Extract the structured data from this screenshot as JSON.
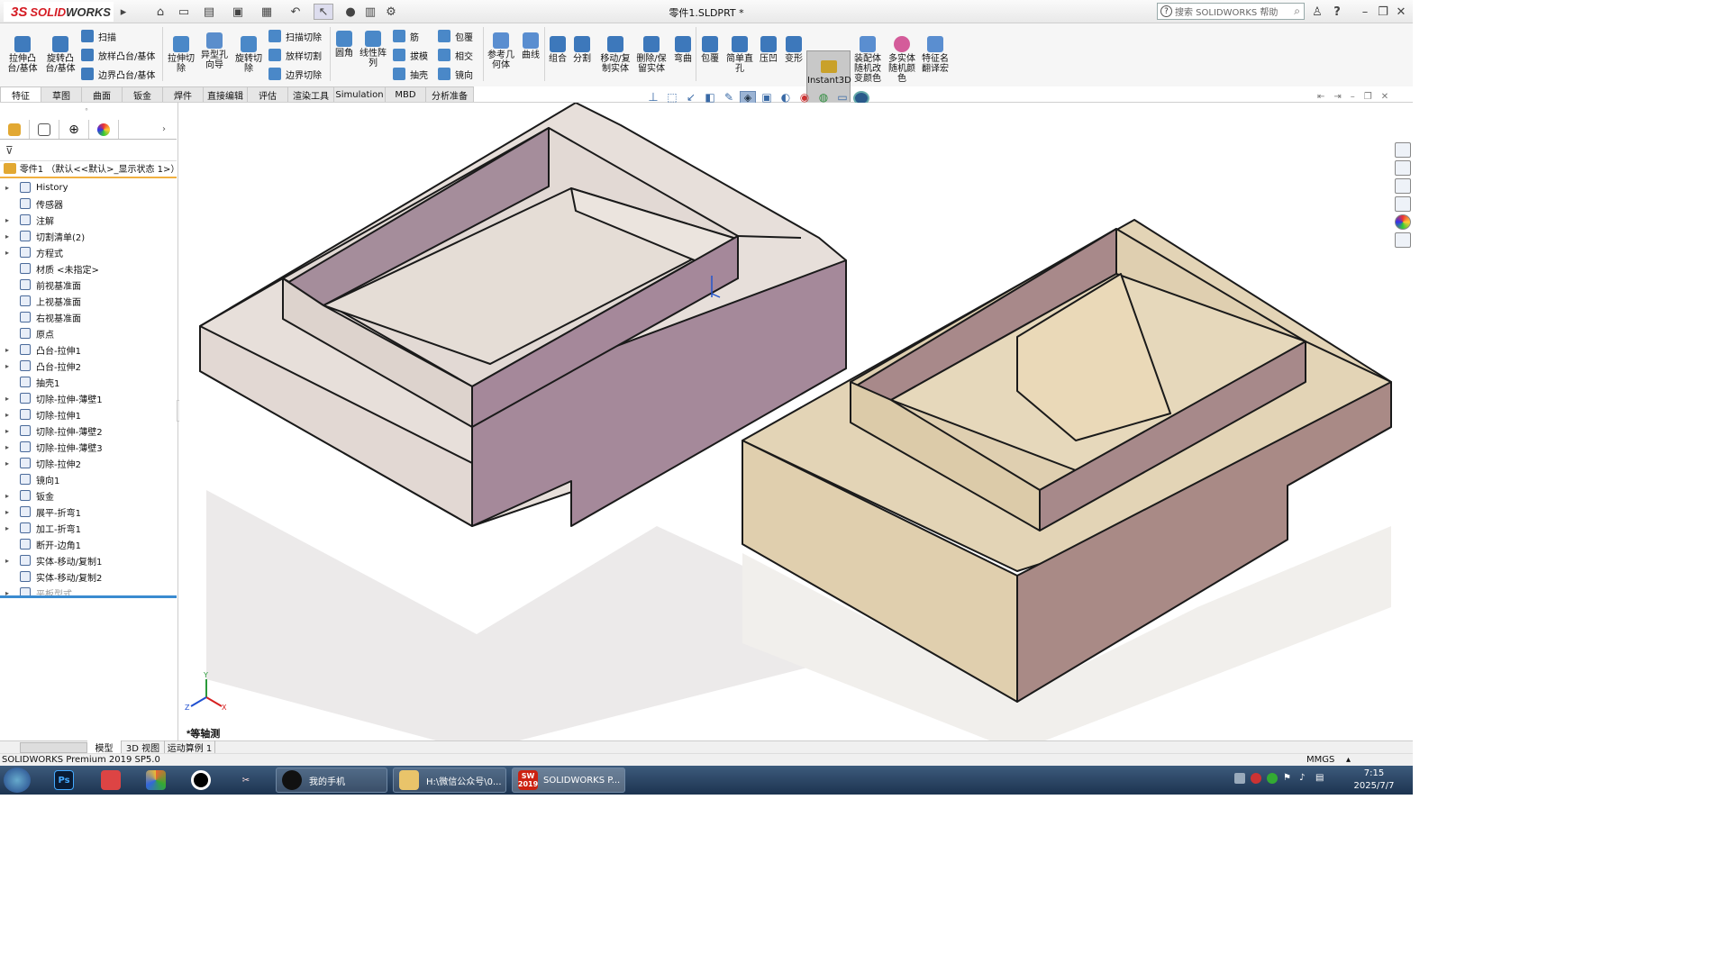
{
  "titlebar": {
    "logo_ds": "3S",
    "logo_solid": "SOLID",
    "logo_works": "WORKS",
    "doc_title": "零件1.SLDPRT *",
    "search_placeholder": "搜索 SOLIDWORKS 帮助",
    "help": "?"
  },
  "ribbon": {
    "large": [
      {
        "label": "拉伸凸\n台/基体",
        "color": "#3f7bbd"
      },
      {
        "label": "旋转凸\n台/基体",
        "color": "#3f7bbd"
      },
      {
        "label": "拉伸切\n除",
        "color": "#4a88c8"
      },
      {
        "label": "异型孔\n向导",
        "color": "#5b8ecc"
      },
      {
        "label": "旋转切\n除",
        "color": "#4a88c8"
      },
      {
        "label": "圆角",
        "color": "#4a88c8"
      },
      {
        "label": "线性阵\n列",
        "color": "#4a88c8"
      },
      {
        "label": "参考几\n何体",
        "color": "#5a8ed0"
      },
      {
        "label": "曲线",
        "color": "#5a8ed0"
      },
      {
        "label": "组合",
        "color": "#3d78bb"
      },
      {
        "label": "分割",
        "color": "#3d78bb"
      },
      {
        "label": "移动/复\n制实体",
        "color": "#3d78bb"
      },
      {
        "label": "删除/保\n留实体",
        "color": "#3d78bb"
      },
      {
        "label": "弯曲",
        "color": "#3d78bb"
      },
      {
        "label": "包覆",
        "color": "#3d78bb"
      },
      {
        "label": "简单直\n孔",
        "color": "#3d78bb"
      },
      {
        "label": "压凹",
        "color": "#3d78bb"
      },
      {
        "label": "变形",
        "color": "#3d78bb"
      },
      {
        "label": "装配体\n随机改\n变颜色",
        "color": "#5a8ed0"
      },
      {
        "label": "多实体\n随机颜\n色",
        "color": "#d45c9a"
      },
      {
        "label": "特征名\n翻译宏",
        "color": "#5a8ed0"
      }
    ],
    "small": [
      {
        "label": "扫描",
        "color": "#3f7bbd"
      },
      {
        "label": "放样凸台/基体",
        "color": "#3f7bbd"
      },
      {
        "label": "边界凸台/基体",
        "color": "#3f7bbd"
      },
      {
        "label": "扫描切除",
        "color": "#4a88c8"
      },
      {
        "label": "放样切割",
        "color": "#4a88c8"
      },
      {
        "label": "边界切除",
        "color": "#4a88c8"
      },
      {
        "label": "筋",
        "color": "#4a88c8"
      },
      {
        "label": "拔模",
        "color": "#4a88c8"
      },
      {
        "label": "抽壳",
        "color": "#4a88c8"
      },
      {
        "label": "包覆",
        "color": "#4a88c8"
      },
      {
        "label": "相交",
        "color": "#4a88c8"
      },
      {
        "label": "镜向",
        "color": "#4a88c8"
      }
    ],
    "instant3d": "Instant3D"
  },
  "tabs": [
    "特征",
    "草图",
    "曲面",
    "钣金",
    "焊件",
    "直接编辑",
    "评估",
    "渲染工具",
    "Simulation",
    "MBD",
    "分析准备"
  ],
  "tree": {
    "root": "零件1 （默认<<默认>_显示状态 1>）",
    "items": [
      {
        "label": "History",
        "arrow": "▸"
      },
      {
        "label": "传感器",
        "arrow": ""
      },
      {
        "label": "注解",
        "arrow": "▸"
      },
      {
        "label": "切割清单(2)",
        "arrow": "▸"
      },
      {
        "label": "方程式",
        "arrow": "▸"
      },
      {
        "label": "材质 <未指定>",
        "arrow": ""
      },
      {
        "label": "前视基准面",
        "arrow": ""
      },
      {
        "label": "上视基准面",
        "arrow": ""
      },
      {
        "label": "右视基准面",
        "arrow": ""
      },
      {
        "label": "原点",
        "arrow": ""
      },
      {
        "label": "凸台-拉伸1",
        "arrow": "▸"
      },
      {
        "label": "凸台-拉伸2",
        "arrow": "▸"
      },
      {
        "label": "抽壳1",
        "arrow": ""
      },
      {
        "label": "切除-拉伸-薄壁1",
        "arrow": "▸"
      },
      {
        "label": "切除-拉伸1",
        "arrow": "▸"
      },
      {
        "label": "切除-拉伸-薄壁2",
        "arrow": "▸"
      },
      {
        "label": "切除-拉伸-薄壁3",
        "arrow": "▸"
      },
      {
        "label": "切除-拉伸2",
        "arrow": "▸"
      },
      {
        "label": "镜向1",
        "arrow": ""
      },
      {
        "label": "钣金",
        "arrow": "▸"
      },
      {
        "label": "展平-折弯1",
        "arrow": "▸"
      },
      {
        "label": "加工-折弯1",
        "arrow": "▸"
      },
      {
        "label": "断开-边角1",
        "arrow": ""
      },
      {
        "label": "实体-移动/复制1",
        "arrow": "▸"
      },
      {
        "label": "实体-移动/复制2",
        "arrow": ""
      },
      {
        "label": "平板型式",
        "arrow": "▸"
      }
    ]
  },
  "viewport": {
    "view_label": "*等轴测",
    "triad_x": "X",
    "triad_y": "Y",
    "triad_z": "Z"
  },
  "bottom_tabs": [
    "模型",
    "3D 视图",
    "运动算例 1"
  ],
  "status": {
    "left": "SOLIDWORKS Premium 2019 SP5.0",
    "units": "MMGS",
    "arrow": "▴"
  },
  "taskbar": {
    "ps": "Ps",
    "qq": "我的手机",
    "folder": "H:\\微信公众号\\0...",
    "sw": "SOLIDWORKS P...",
    "sw_badge": "2019",
    "time": "7:15",
    "date": "2025/7/7"
  },
  "colors": {
    "accent": "#d51c24",
    "part_left_top": "#e6ddd8",
    "part_left_side": "#a5899a",
    "part_right_top": "#e3d4b6",
    "part_right_side": "#a98a86",
    "tree_highlight": "#f1b040"
  }
}
